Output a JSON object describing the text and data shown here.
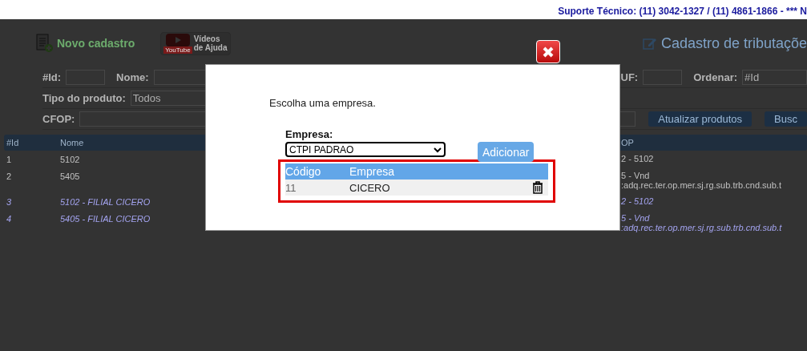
{
  "top_bar": {
    "support_text": "Suporte Técnico: (11) 3042-1327 / (11) 4861-1866 - *** N"
  },
  "header": {
    "new_button": "Novo cadastro",
    "video_button": {
      "logo": "YouTube",
      "line1": "Vídeos",
      "line2": "de Ajuda"
    },
    "title": "Cadastro de tributaçõe"
  },
  "filter_rows": [
    {
      "items": [
        {
          "kind": "label",
          "text": "#Id:"
        },
        {
          "kind": "input"
        },
        {
          "kind": "label",
          "text": "Nome:"
        },
        {
          "kind": "input"
        },
        {
          "kind": "label",
          "text": "UF:"
        },
        {
          "kind": "input"
        },
        {
          "kind": "label",
          "text": "Ordenar:"
        },
        {
          "kind": "select",
          "value": "#Id"
        }
      ]
    },
    {
      "items": [
        {
          "kind": "label",
          "text": "Tipo do produto:"
        },
        {
          "kind": "select",
          "value": "Todos"
        }
      ]
    },
    {
      "items": [
        {
          "kind": "label",
          "text": "CFOP:"
        },
        {
          "kind": "input"
        },
        {
          "kind": "button",
          "text": "Atualizar produtos"
        },
        {
          "kind": "button",
          "text": "Busc"
        }
      ]
    }
  ],
  "table": {
    "columns": [
      "#Id",
      "Nome"
    ],
    "right_column": "OP",
    "rows": [
      {
        "id": "1",
        "name": "5102",
        "right": [
          "2 - 5102"
        ],
        "italic": false
      },
      {
        "id": "2",
        "name": "5405",
        "right": [
          "5 - Vnd",
          ":adq.rec.ter.op.mer.sj.rg.sub.trb.cnd.sub.t"
        ],
        "italic": false
      },
      {
        "id": "3",
        "name": "5102 - FILIAL CICERO",
        "right": [
          "2 - 5102"
        ],
        "italic": true
      },
      {
        "id": "4",
        "name": "5405 - FILIAL CICERO",
        "right": [
          "5 - Vnd",
          ":adq.rec.ter.op.mer.sj.rg.sub.trb.cnd.sub.t"
        ],
        "italic": true
      }
    ]
  },
  "modal": {
    "prompt": "Escolha uma empresa.",
    "field_label": "Empresa:",
    "select_value": "CTPI PADRAO",
    "add_button": "Adicionar",
    "table": {
      "columns": [
        "Código",
        "Empresa"
      ],
      "rows": [
        {
          "code": "11",
          "company": "CICERO"
        }
      ]
    }
  }
}
